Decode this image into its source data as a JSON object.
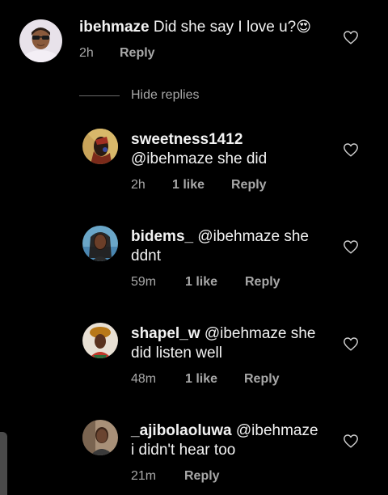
{
  "main_comment": {
    "username": "ibehmaze",
    "text": "Did she say I love u?",
    "emoji": "😍",
    "time": "2h",
    "reply_label": "Reply"
  },
  "hide_replies_label": "Hide replies",
  "replies": [
    {
      "username": "sweetness1412",
      "mention": "@ibehmaze",
      "text": "she did",
      "time": "2h",
      "likes": "1 like",
      "reply_label": "Reply"
    },
    {
      "username": "bidems_",
      "mention": "@ibehmaze",
      "text_line1": "she",
      "text_line2": "ddnt",
      "time": "59m",
      "likes": "1 like",
      "reply_label": "Reply"
    },
    {
      "username": "shapel_w",
      "mention": "@ibehmaze",
      "text_line1": "she",
      "text_line2": "did listen well",
      "time": "48m",
      "likes": "1 like",
      "reply_label": "Reply"
    },
    {
      "username": "_ajibolaoluwa",
      "mention": "@ibehmaze",
      "text_line2": "i didn't hear too",
      "time": "21m",
      "reply_label": "Reply"
    }
  ],
  "icons": {
    "like": "heart-outline-icon"
  }
}
